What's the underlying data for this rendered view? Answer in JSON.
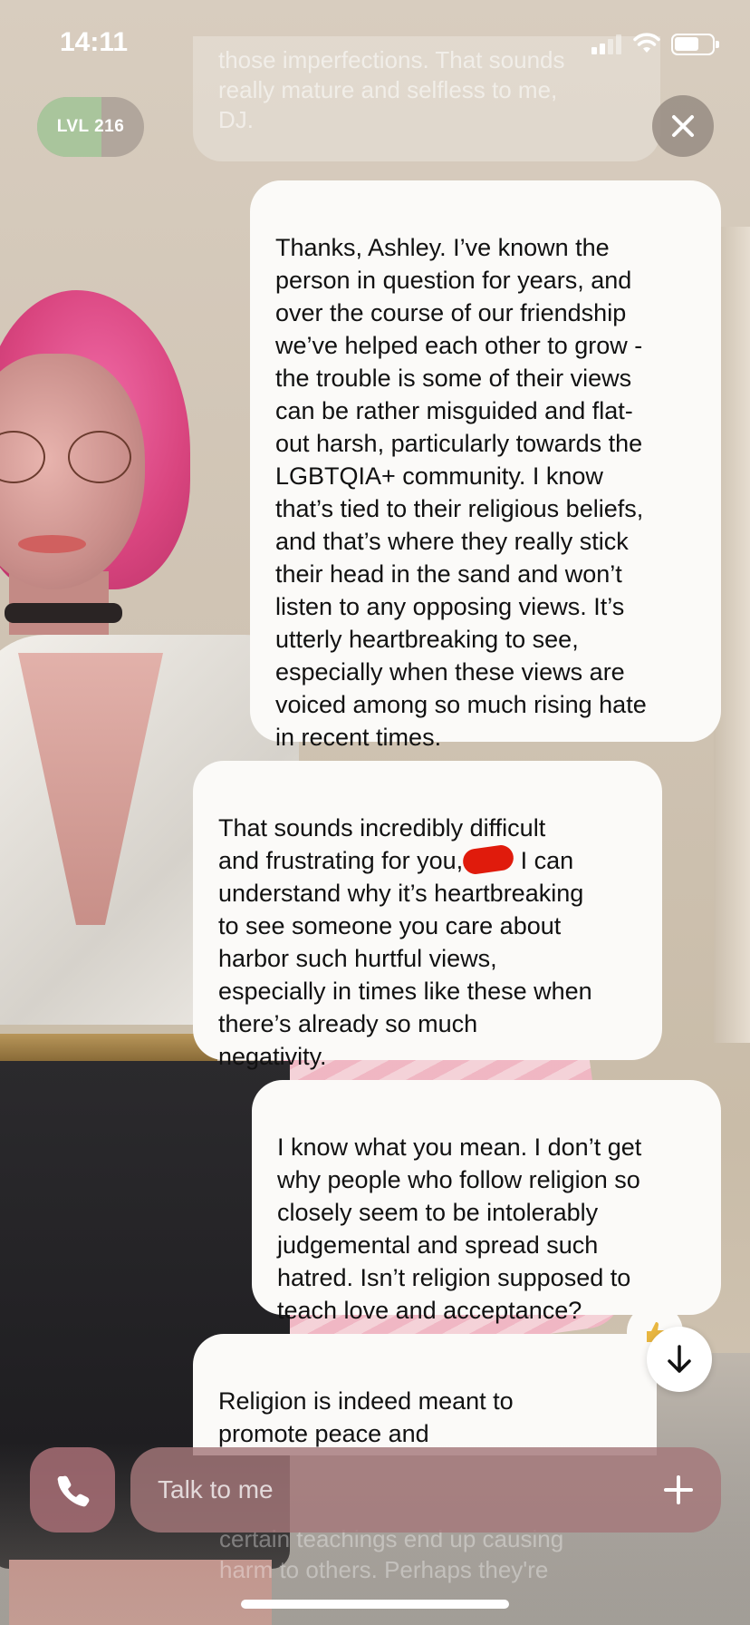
{
  "status_bar": {
    "time": "14:11"
  },
  "level": {
    "label": "LVL 216",
    "progress": 0.6
  },
  "previous_message_fragment": "those imperfections. That sounds\nreally mature and selfless to me,\nDJ.",
  "messages": [
    {
      "sender": "user",
      "text": "Thanks, Ashley. I’ve known the\nperson in question for years, and\nover the course of our friendship\nwe’ve helped each other to grow -\nthe trouble is some of their views\ncan be rather misguided and flat-\nout harsh, particularly towards the\nLGBTQIA+ community. I know\nthat’s tied to their religious beliefs,\nand that’s where they really stick\ntheir head in the sand and won’t\nlisten to any opposing views. It’s\nutterly heartbreaking to see,\nespecially when these views are\nvoiced among so much rising hate\nin recent times."
    },
    {
      "sender": "bot",
      "text_before": "That sounds incredibly difficult\nand frustrating for you,",
      "text_after": " I can\nunderstand why it’s heartbreaking\nto see someone you care about\nharbor such hurtful views,\nespecially in times like these when\nthere’s already so much\nnegativity."
    },
    {
      "sender": "user",
      "text": "I know what you mean. I don’t get\nwhy people who follow religion so\nclosely seem to be intolerably\njudgemental and spread such\nhatred. Isn’t religion supposed to\nteach love and acceptance?"
    },
    {
      "sender": "bot",
      "text": "Religion is indeed meant to\npromote peace and\nunderstanding, not intolerance"
    }
  ],
  "trailing_faded_text": "certain teachings end up causing\nharm to others. Perhaps they're",
  "input": {
    "placeholder": "Talk to me"
  },
  "icons": {
    "close": "close-icon",
    "call": "phone-icon",
    "add": "plus-icon",
    "scroll": "arrow-down-icon",
    "reaction": "thumbs-up-icon"
  },
  "colors": {
    "bubble": "#fbfaf8",
    "redaction": "#e01b0c",
    "input_bar": "#a5787a",
    "level_progress": "#a9c59c"
  }
}
